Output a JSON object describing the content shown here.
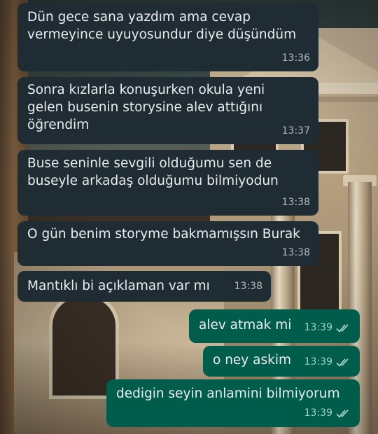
{
  "messages": [
    {
      "dir": "in",
      "text": "Dün gece sana yazdım ama cevap\nvermeyince uyuyosundur diye düşündüm",
      "time": "13:36"
    },
    {
      "dir": "in",
      "text": "Sonra kızlarla konuşurken okula yeni\ngelen busenin storysine alev attığını\nöğrendim",
      "time": "13:37"
    },
    {
      "dir": "in",
      "text": "Buse seninle sevgili olduğumu sen de\nbuseyle arkadaş olduğumu bilmiyodun",
      "time": "13:38"
    },
    {
      "dir": "in",
      "text": "O gün benim storyme bakmamışsın Burak",
      "time": "13:38"
    },
    {
      "dir": "in",
      "text": "Mantıklı bi açıklaman var mı",
      "time": "13:38"
    },
    {
      "dir": "out",
      "text": "alev atmak mi",
      "time": "13:39",
      "status": "read-double-check"
    },
    {
      "dir": "out",
      "text": "o ney askim",
      "time": "13:39",
      "status": "read-double-check"
    },
    {
      "dir": "out",
      "text": "dedigin seyin anlamini bilmiyorum",
      "time": "13:39",
      "status": "read-double-check"
    }
  ],
  "colors": {
    "incoming": "#202c33",
    "outgoing": "#005c4b",
    "text": "#e9edef"
  },
  "icons": {
    "read_status": "double-check-icon"
  }
}
